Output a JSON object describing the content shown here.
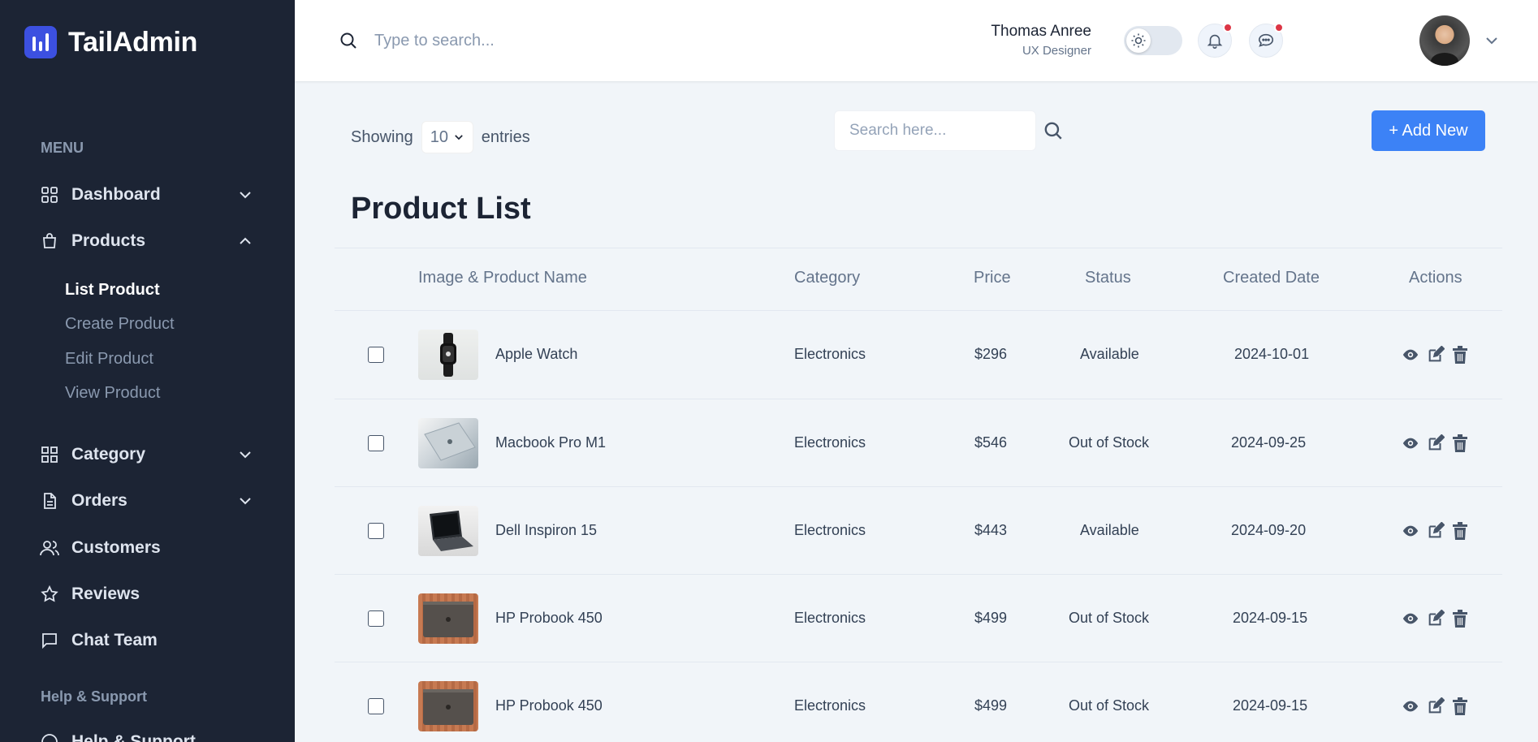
{
  "brand": {
    "name": "TailAdmin"
  },
  "sidebar": {
    "menu_label": "MENU",
    "items": [
      {
        "label": "Dashboard"
      },
      {
        "label": "Products"
      },
      {
        "label": "Category"
      },
      {
        "label": "Orders"
      },
      {
        "label": "Customers"
      },
      {
        "label": "Reviews"
      },
      {
        "label": "Chat Team"
      }
    ],
    "products_submenu": [
      "List Product",
      "Create Product",
      "Edit Product",
      "View Product"
    ],
    "help_label": "Help & Support",
    "help_item": "Help & Support"
  },
  "header": {
    "search_placeholder": "Type to search...",
    "user_name": "Thomas Anree",
    "user_role": "UX Designer"
  },
  "toolbar": {
    "showing_label": "Showing",
    "entries_value": "10",
    "entries_label": "entries",
    "search_placeholder": "Search here...",
    "add_label": "+ Add New"
  },
  "page": {
    "title": "Product List"
  },
  "table": {
    "headers": [
      "Image & Product Name",
      "Category",
      "Price",
      "Status",
      "Created Date",
      "Actions"
    ],
    "rows": [
      {
        "name": "Apple Watch",
        "category": "Electronics",
        "price": "$296",
        "status": "Available",
        "date": "2024-10-01"
      },
      {
        "name": "Macbook Pro M1",
        "category": "Electronics",
        "price": "$546",
        "status": "Out of Stock",
        "date": "2024-09-25"
      },
      {
        "name": "Dell Inspiron 15",
        "category": "Electronics",
        "price": "$443",
        "status": "Available",
        "date": "2024-09-20"
      },
      {
        "name": "HP Probook 450",
        "category": "Electronics",
        "price": "$499",
        "status": "Out of Stock",
        "date": "2024-09-15"
      },
      {
        "name": "HP Probook 450",
        "category": "Electronics",
        "price": "$499",
        "status": "Out of Stock",
        "date": "2024-09-15"
      }
    ]
  },
  "colors": {
    "sidebar_bg": "#1c2434",
    "accent": "#3c50e0",
    "button_blue": "#3c82f6",
    "badge_red": "#dc3545"
  },
  "icons": [
    "search-icon",
    "sun-icon",
    "bell-icon",
    "chat-icon",
    "chevron-down-icon",
    "eye-icon",
    "edit-icon",
    "trash-icon"
  ]
}
